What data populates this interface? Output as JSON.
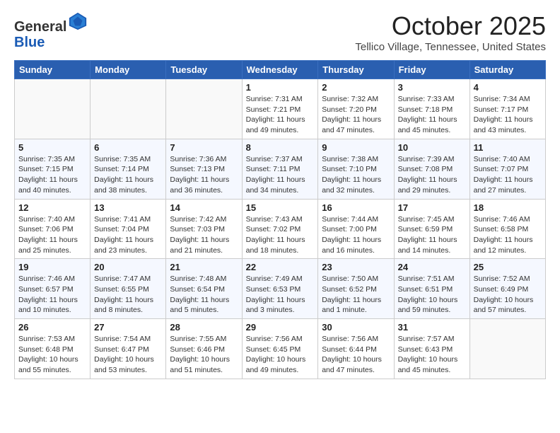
{
  "header": {
    "logo_general": "General",
    "logo_blue": "Blue",
    "month": "October 2025",
    "location": "Tellico Village, Tennessee, United States"
  },
  "days_of_week": [
    "Sunday",
    "Monday",
    "Tuesday",
    "Wednesday",
    "Thursday",
    "Friday",
    "Saturday"
  ],
  "weeks": [
    [
      {
        "day": "",
        "info": ""
      },
      {
        "day": "",
        "info": ""
      },
      {
        "day": "",
        "info": ""
      },
      {
        "day": "1",
        "info": "Sunrise: 7:31 AM\nSunset: 7:21 PM\nDaylight: 11 hours and 49 minutes."
      },
      {
        "day": "2",
        "info": "Sunrise: 7:32 AM\nSunset: 7:20 PM\nDaylight: 11 hours and 47 minutes."
      },
      {
        "day": "3",
        "info": "Sunrise: 7:33 AM\nSunset: 7:18 PM\nDaylight: 11 hours and 45 minutes."
      },
      {
        "day": "4",
        "info": "Sunrise: 7:34 AM\nSunset: 7:17 PM\nDaylight: 11 hours and 43 minutes."
      }
    ],
    [
      {
        "day": "5",
        "info": "Sunrise: 7:35 AM\nSunset: 7:15 PM\nDaylight: 11 hours and 40 minutes."
      },
      {
        "day": "6",
        "info": "Sunrise: 7:35 AM\nSunset: 7:14 PM\nDaylight: 11 hours and 38 minutes."
      },
      {
        "day": "7",
        "info": "Sunrise: 7:36 AM\nSunset: 7:13 PM\nDaylight: 11 hours and 36 minutes."
      },
      {
        "day": "8",
        "info": "Sunrise: 7:37 AM\nSunset: 7:11 PM\nDaylight: 11 hours and 34 minutes."
      },
      {
        "day": "9",
        "info": "Sunrise: 7:38 AM\nSunset: 7:10 PM\nDaylight: 11 hours and 32 minutes."
      },
      {
        "day": "10",
        "info": "Sunrise: 7:39 AM\nSunset: 7:08 PM\nDaylight: 11 hours and 29 minutes."
      },
      {
        "day": "11",
        "info": "Sunrise: 7:40 AM\nSunset: 7:07 PM\nDaylight: 11 hours and 27 minutes."
      }
    ],
    [
      {
        "day": "12",
        "info": "Sunrise: 7:40 AM\nSunset: 7:06 PM\nDaylight: 11 hours and 25 minutes."
      },
      {
        "day": "13",
        "info": "Sunrise: 7:41 AM\nSunset: 7:04 PM\nDaylight: 11 hours and 23 minutes."
      },
      {
        "day": "14",
        "info": "Sunrise: 7:42 AM\nSunset: 7:03 PM\nDaylight: 11 hours and 21 minutes."
      },
      {
        "day": "15",
        "info": "Sunrise: 7:43 AM\nSunset: 7:02 PM\nDaylight: 11 hours and 18 minutes."
      },
      {
        "day": "16",
        "info": "Sunrise: 7:44 AM\nSunset: 7:00 PM\nDaylight: 11 hours and 16 minutes."
      },
      {
        "day": "17",
        "info": "Sunrise: 7:45 AM\nSunset: 6:59 PM\nDaylight: 11 hours and 14 minutes."
      },
      {
        "day": "18",
        "info": "Sunrise: 7:46 AM\nSunset: 6:58 PM\nDaylight: 11 hours and 12 minutes."
      }
    ],
    [
      {
        "day": "19",
        "info": "Sunrise: 7:46 AM\nSunset: 6:57 PM\nDaylight: 11 hours and 10 minutes."
      },
      {
        "day": "20",
        "info": "Sunrise: 7:47 AM\nSunset: 6:55 PM\nDaylight: 11 hours and 8 minutes."
      },
      {
        "day": "21",
        "info": "Sunrise: 7:48 AM\nSunset: 6:54 PM\nDaylight: 11 hours and 5 minutes."
      },
      {
        "day": "22",
        "info": "Sunrise: 7:49 AM\nSunset: 6:53 PM\nDaylight: 11 hours and 3 minutes."
      },
      {
        "day": "23",
        "info": "Sunrise: 7:50 AM\nSunset: 6:52 PM\nDaylight: 11 hours and 1 minute."
      },
      {
        "day": "24",
        "info": "Sunrise: 7:51 AM\nSunset: 6:51 PM\nDaylight: 10 hours and 59 minutes."
      },
      {
        "day": "25",
        "info": "Sunrise: 7:52 AM\nSunset: 6:49 PM\nDaylight: 10 hours and 57 minutes."
      }
    ],
    [
      {
        "day": "26",
        "info": "Sunrise: 7:53 AM\nSunset: 6:48 PM\nDaylight: 10 hours and 55 minutes."
      },
      {
        "day": "27",
        "info": "Sunrise: 7:54 AM\nSunset: 6:47 PM\nDaylight: 10 hours and 53 minutes."
      },
      {
        "day": "28",
        "info": "Sunrise: 7:55 AM\nSunset: 6:46 PM\nDaylight: 10 hours and 51 minutes."
      },
      {
        "day": "29",
        "info": "Sunrise: 7:56 AM\nSunset: 6:45 PM\nDaylight: 10 hours and 49 minutes."
      },
      {
        "day": "30",
        "info": "Sunrise: 7:56 AM\nSunset: 6:44 PM\nDaylight: 10 hours and 47 minutes."
      },
      {
        "day": "31",
        "info": "Sunrise: 7:57 AM\nSunset: 6:43 PM\nDaylight: 10 hours and 45 minutes."
      },
      {
        "day": "",
        "info": ""
      }
    ]
  ]
}
